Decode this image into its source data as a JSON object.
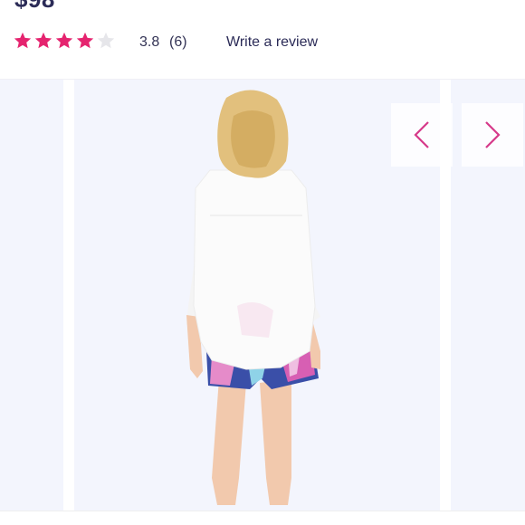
{
  "product": {
    "price": "$98"
  },
  "rating": {
    "stars_filled": 4,
    "stars_total": 5,
    "value": "3.8",
    "count": "(6)",
    "write_review_label": "Write a review"
  },
  "gallery": {
    "prev_icon": "chevron-left-icon",
    "next_icon": "chevron-right-icon"
  },
  "colors": {
    "star_filled": "#e5246f",
    "star_empty": "#e6e6ea",
    "arrow": "#d63a8a",
    "text_dark": "#2b2b57",
    "slide_bg": "#f3f5fd"
  }
}
